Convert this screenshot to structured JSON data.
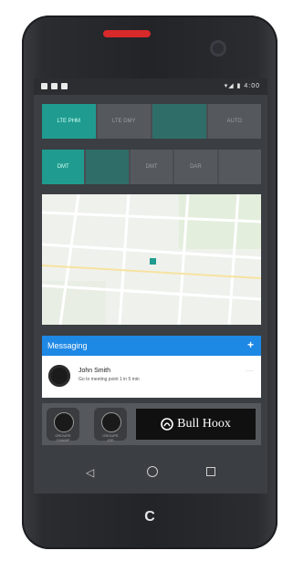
{
  "status_bar": {
    "time": "4:00"
  },
  "mode_row": {
    "buttons": [
      "LTE PHM",
      "LTE DMY",
      "",
      "AUTO"
    ],
    "active_index": 0
  },
  "channel_row": {
    "buttons": [
      "DMT",
      "",
      "DMT",
      "DAR",
      ""
    ],
    "active_index": 0
  },
  "messaging": {
    "title": "Messaging",
    "add_symbol": "+",
    "message": {
      "name": "John Smith",
      "text": "Go to meeting point 1 in 5 min",
      "more": "..."
    }
  },
  "radios": [
    {
      "label_line1": "GROUPE",
      "label_line2": "CHAMP"
    },
    {
      "label_line1": "GROUPE",
      "label_line2": "JSD"
    }
  ],
  "logo": {
    "text": "Bull Hoox"
  },
  "nav": {
    "back": "◁",
    "home": "○",
    "recent": "□"
  },
  "colors": {
    "accent": "#1f9c8f",
    "messaging": "#1e88e5",
    "speaker": "#d8292b"
  }
}
